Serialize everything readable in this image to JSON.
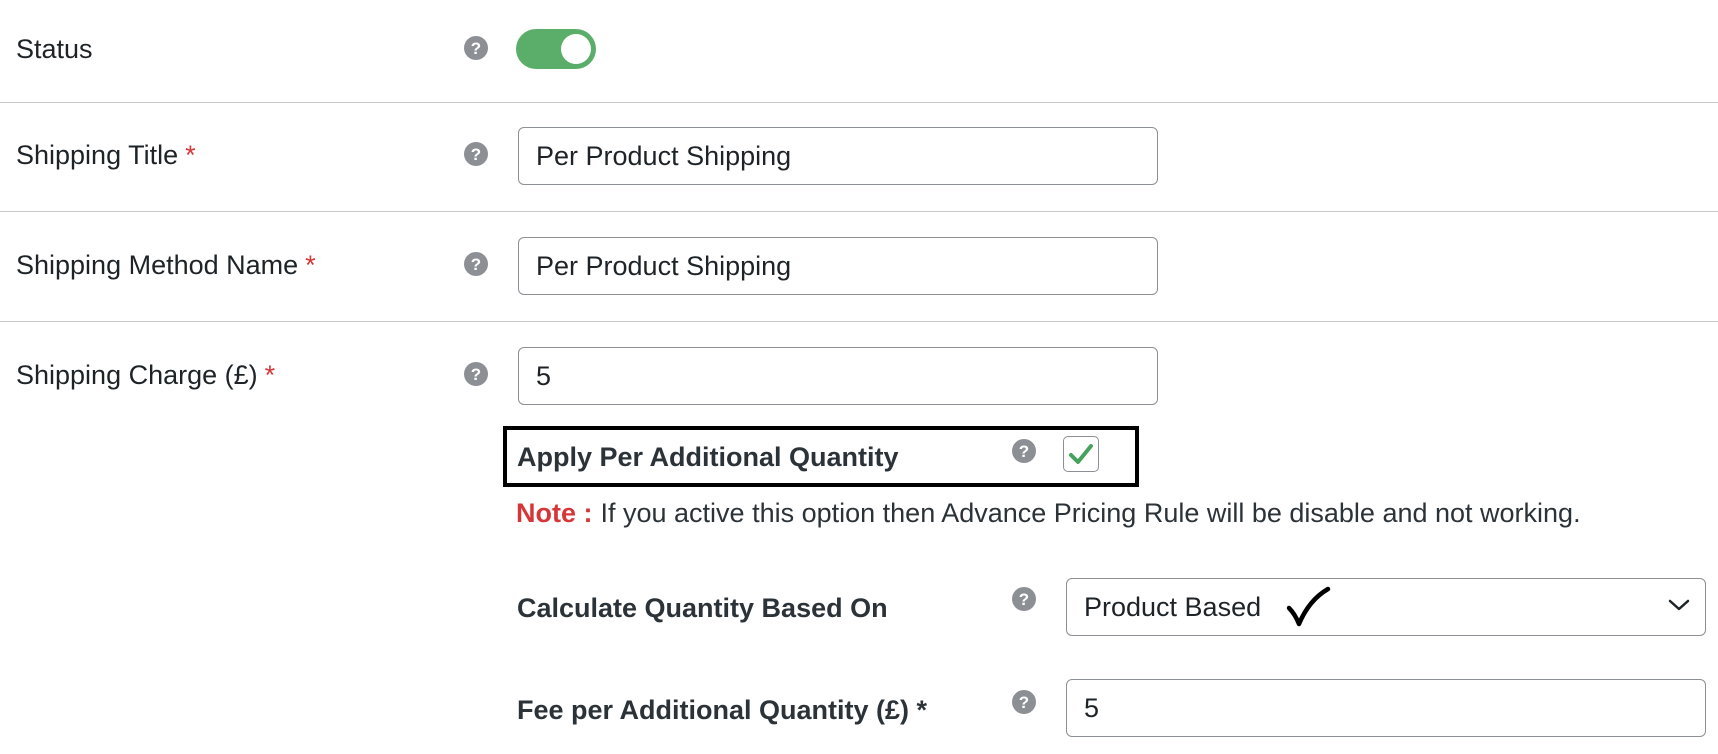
{
  "status": {
    "label": "Status",
    "toggle_on": true,
    "toggle_color": "#5aae6a"
  },
  "shipping_title": {
    "label": "Shipping Title",
    "required_mark": "*",
    "value": "Per Product Shipping"
  },
  "method_name": {
    "label": "Shipping Method Name",
    "required_mark": "*",
    "value": "Per Product Shipping"
  },
  "shipping_charge": {
    "label": "Shipping Charge (£)",
    "required_mark": "*",
    "value": "5"
  },
  "apply_additional": {
    "label": "Apply Per Additional Quantity",
    "checked": true,
    "check_color": "#46a35e"
  },
  "note": {
    "key": "Note :",
    "text": "If you active this option then Advance Pricing Rule will be disable and not working."
  },
  "calculate_based_on": {
    "label": "Calculate Quantity Based On",
    "selected": "Product Based"
  },
  "fee_per_additional": {
    "label": "Fee per Additional Quantity (£) *",
    "value": "5"
  },
  "help_icon_glyph": "?",
  "colors": {
    "required": "#d63638",
    "help_icon": "#8c8f94"
  }
}
